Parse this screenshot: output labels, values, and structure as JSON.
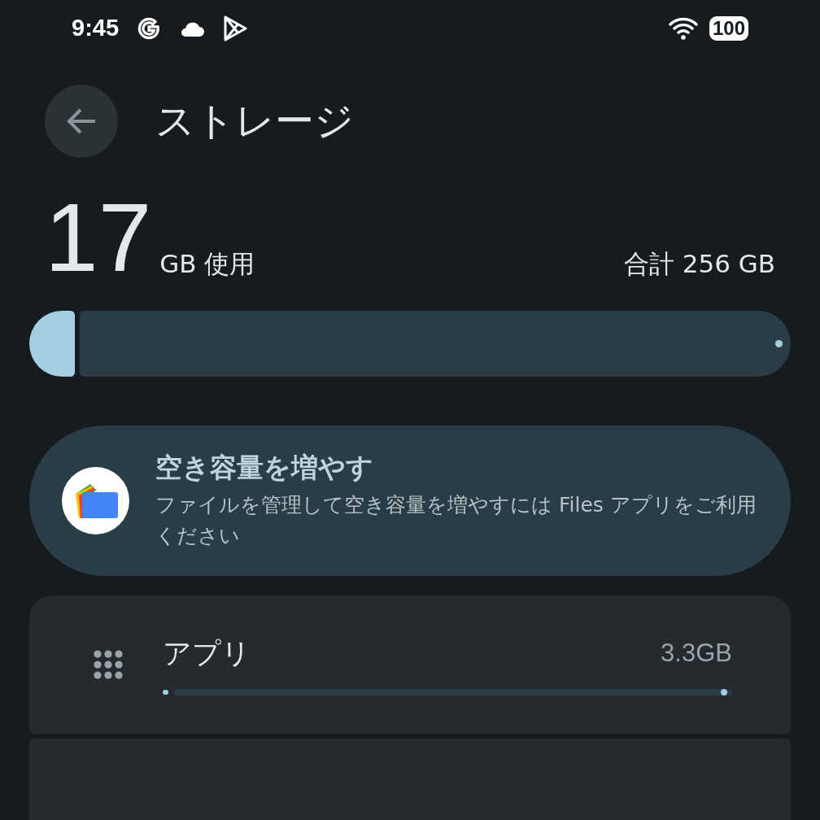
{
  "status_bar": {
    "time": "9:45",
    "battery": "100"
  },
  "header": {
    "title": "ストレージ"
  },
  "usage": {
    "used": "17",
    "used_unit": "GB 使用",
    "total": "合計 256 GB",
    "level": 0.06
  },
  "free_up": {
    "title": "空き容量を増やす",
    "description": "ファイルを管理して空き容量を増やすには Files アプリをご利用ください"
  },
  "categories": [
    {
      "name": "アプリ",
      "size": "3.3GB",
      "level": 0.01
    }
  ]
}
